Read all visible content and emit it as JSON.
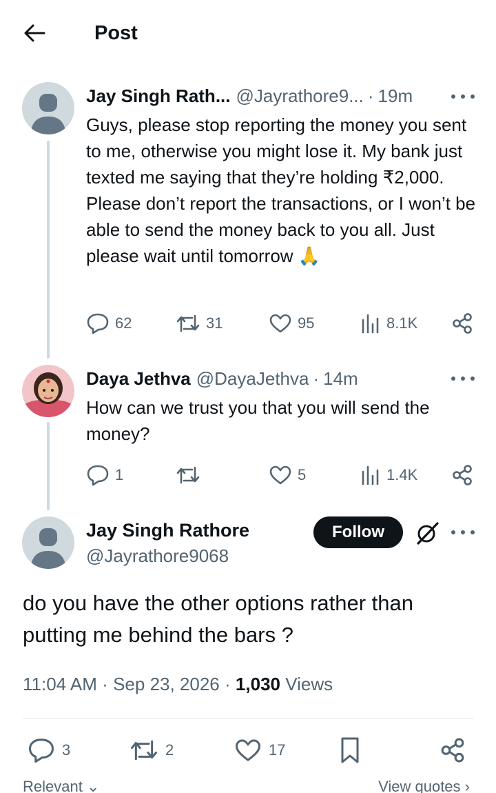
{
  "header": {
    "title": "Post",
    "back_icon": "arrow-left-icon"
  },
  "thread": [
    {
      "display_name": "Jay Singh Rath...",
      "handle": "@Jayrathore9...",
      "separator": "·",
      "time": "19m",
      "text": "Guys, please stop reporting the money you sent to me, otherwise you might lose it. My bank just texted me saying that they’re holding ₹2,000. Please don’t report the transactions, or I won’t be able to send the money back to you all. Just please wait until tomorrow 🙏",
      "replies": "62",
      "reposts": "31",
      "likes": "95",
      "views": "8.1K"
    },
    {
      "display_name": "Daya Jethva",
      "handle": "@DayaJethva",
      "separator": "·",
      "time": "14m",
      "text": "How can we trust you that you will send the money?",
      "replies": "1",
      "reposts": "",
      "likes": "5",
      "views": "1.4K"
    }
  ],
  "main_post": {
    "display_name": "Jay Singh Rathore",
    "handle": "@Jayrathore9068",
    "follow_label": "Follow",
    "text": "do you have the other options rather than putting me behind the bars ?",
    "time": "11:04 AM",
    "date": "Sep 23, 2026",
    "separator": "·",
    "views_count": "1,030",
    "views_label": "Views",
    "replies": "3",
    "reposts": "2",
    "likes": "17"
  },
  "bottom": {
    "sort_label": "Relevant",
    "view_quotes_label": "View quotes"
  },
  "colors": {
    "text": "#0f1419",
    "secondary": "#536471",
    "thread_line": "#cfd9de",
    "follow_bg": "#0f1419"
  }
}
